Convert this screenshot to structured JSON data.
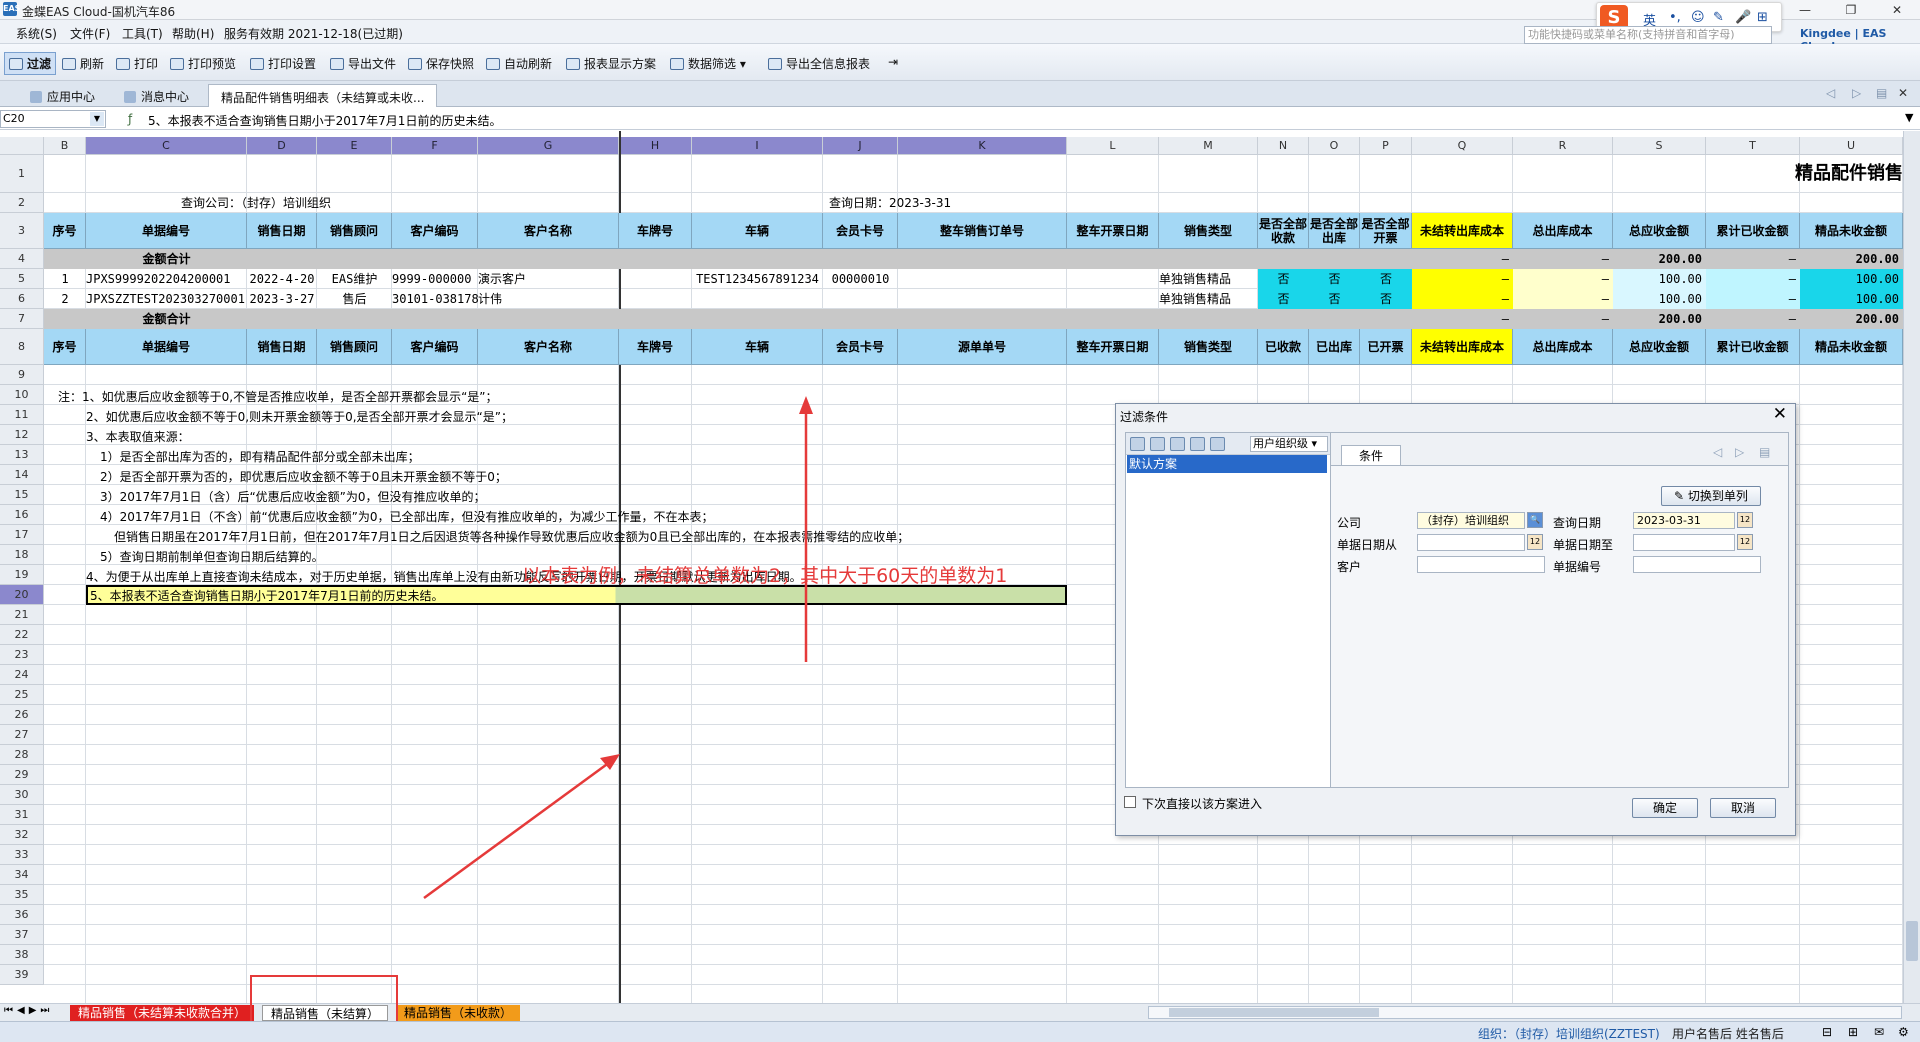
{
  "window": {
    "title": "金蝶EAS Cloud-国机汽车86",
    "controls": [
      "—",
      "❐",
      "✕"
    ]
  },
  "menu": {
    "items": [
      "系统(S)",
      "文件(F)",
      "工具(T)",
      "帮助(H)",
      "服务有效期 2021-12-18(已过期)"
    ]
  },
  "ime": {
    "logo": "S",
    "glyphs": [
      "英",
      "•,",
      "☺",
      "✎",
      "🎤",
      "⊞"
    ]
  },
  "search": {
    "placeholder": "功能快捷码或菜单名称(支持拼音和首字母)"
  },
  "brand": {
    "name": "Kingdee | EAS Cloud"
  },
  "toolbar": {
    "items": [
      "过滤",
      "刷新",
      "打印",
      "打印预览",
      "打印设置",
      "导出文件",
      "保存快照",
      "自动刷新",
      "报表显示方案",
      "数据筛选",
      "导出全信息报表"
    ]
  },
  "tabs": {
    "items": [
      "应用中心",
      "消息中心",
      "精品配件销售明细表（未结算或未收..."
    ]
  },
  "formula": {
    "cell": "C20",
    "text": "5、本报表不适合查询销售日期小于2017年7月1日前的历史未结。"
  },
  "sheet": {
    "columns": [
      "B",
      "C",
      "D",
      "E",
      "F",
      "G",
      "H",
      "I",
      "J",
      "K",
      "L",
      "M",
      "N",
      "O",
      "P",
      "Q",
      "R",
      "S",
      "T",
      "U"
    ],
    "selected_columns": [
      "C",
      "D",
      "E",
      "F",
      "G",
      "H",
      "I",
      "J",
      "K"
    ],
    "rows": [
      "1",
      "2",
      "3",
      "4",
      "5",
      "6",
      "7",
      "8",
      "9",
      "10",
      "11",
      "12",
      "13",
      "14",
      "15",
      "16",
      "17",
      "18",
      "19",
      "20",
      "21",
      "22",
      "23",
      "24",
      "25",
      "26",
      "27",
      "28",
      "29",
      "30",
      "31",
      "32",
      "33",
      "34",
      "35",
      "36",
      "37",
      "38",
      "39"
    ],
    "report_title": "精品配件销售",
    "query_company_label": "查询公司：（封存）培训组织",
    "query_date_label": "查询日期：",
    "query_date": "2023-3-31",
    "header_row3": [
      "序号",
      "单据编号",
      "销售日期",
      "销售顾问",
      "客户编码",
      "客户名称",
      "车牌号",
      "车辆",
      "会员卡号",
      "整车销售订单号",
      "整车开票日期",
      "销售类型",
      "是否全部收款",
      "是否全部出库",
      "是否全部开票",
      "未结转出库成本",
      "总出库成本",
      "总应收金额",
      "累计已收金额",
      "精品未收金额"
    ],
    "header_row8": [
      "序号",
      "单据编号",
      "销售日期",
      "销售顾问",
      "客户编码",
      "客户名称",
      "车牌号",
      "车辆",
      "会员卡号",
      "源单单号",
      "整车开票日期",
      "销售类型",
      "已收款",
      "已出库",
      "已开票",
      "未结转出库成本",
      "总出库成本",
      "总应收金额",
      "累计已收金额",
      "精品未收金额"
    ],
    "total_label": "金额合计",
    "total_row4": {
      "q": "—",
      "r": "—",
      "s": "200.00",
      "t": "—",
      "u": "200.00"
    },
    "total_row7": {
      "q": "—",
      "r": "—",
      "s": "200.00",
      "t": "—",
      "u": "200.00"
    },
    "data_rows": [
      {
        "no": "1",
        "doc": "JPXS9999202204200001",
        "date": "2022-4-20",
        "advisor": "EAS维护",
        "code": "9999-000000",
        "name": "演示客户",
        "vehicle": "TEST1234567891234",
        "card": "00000010",
        "type": "单独销售精品",
        "n": "否",
        "o": "否",
        "p": "否",
        "q": "—",
        "r": "—",
        "s": "100.00",
        "t": "—",
        "u": "100.00"
      },
      {
        "no": "2",
        "doc": "JPXSZZTEST202303270001",
        "date": "2023-3-27",
        "advisor": "售后",
        "code": "30101-038178",
        "name": "计伟",
        "vehicle": "",
        "card": "",
        "type": "单独销售精品",
        "n": "否",
        "o": "否",
        "p": "否",
        "q": "—",
        "r": "—",
        "s": "100.00",
        "t": "—",
        "u": "100.00"
      }
    ],
    "notes": [
      "注：1、如优惠后应收金额等于0,不管是否推应收单，是否全部开票都会显示“是”；",
      "2、如优惠后应收金额不等于0,则未开票金额等于0,是否全部开票才会显示“是”；",
      "3、本表取值来源：",
      "1）是否全部出库为否的，即有精品配件部分或全部未出库；",
      "2）是否全部开票为否的，即优惠后应收金额不等于0且未开票金额不等于0；",
      "3）2017年7月1日（含）后“优惠后应收金额”为0，但没有推应收单的；",
      "4）2017年7月1日（不含）前“优惠后应收金额”为0，已全部出库，但没有推应收单的，为减少工作量，不在本表；",
      "但销售日期虽在2017年7月1日前，但在2017年7月1日之后因退货等各种操作导致优惠后应收金额为0且已全部出库的，在本报表需推零结的应收单；",
      "5）查询日期前制单但查询日期后结算的。",
      "4、为便于从出库单上直接查询未结成本，对于历史单据，销售出库单上没有由新功能反写的开票日期，开票日期默认更新为出库日期。",
      "5、本报表不适合查询销售日期小于2017年7月1日前的历史未结。"
    ]
  },
  "annotation": "以本表为例，未结算总单数为2，其中大于60天的单数为1",
  "dialog": {
    "title": "过滤条件",
    "close": "✕",
    "org_select": "用户组织级",
    "scheme": "默认方案",
    "tab": "条件",
    "switch_button": "切换到单列",
    "company_label": "公司",
    "company_value": "（封存）培训组织",
    "query_date_label": "查询日期",
    "query_date_value": "2023-03-31",
    "date_from_label": "单据日期从",
    "date_to_label": "单据日期至",
    "customer_label": "客户",
    "docno_label": "单据编号",
    "checkbox_label": "下次直接以该方案进入",
    "ok": "确定",
    "cancel": "取消"
  },
  "sheet_tabs": [
    "精品销售（未结算未收款合并）",
    "精品销售（未结算）",
    "精品销售（未收款）"
  ],
  "status": {
    "org": "组织：（封存）培训组织(ZZTEST)",
    "user": "用户名售后 姓名售后"
  }
}
